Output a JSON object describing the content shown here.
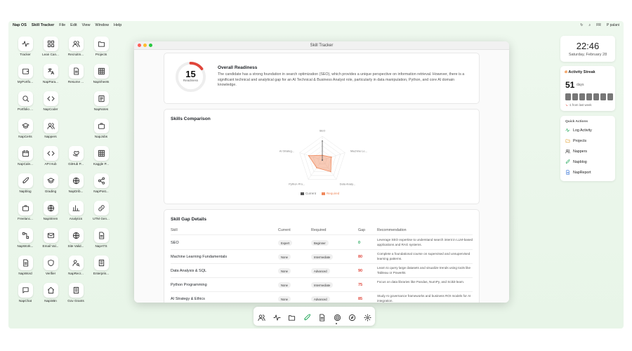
{
  "menubar": {
    "os": "Nap OS",
    "app": "Skill Tracker",
    "items": [
      "File",
      "Edit",
      "View",
      "Window",
      "Help"
    ],
    "lang": "FR",
    "user": "palani",
    "user_initial": "P"
  },
  "desktop_icons": [
    {
      "label": "Tracker",
      "icon": "activity-icon"
    },
    {
      "label": "Lean Can...",
      "icon": "grid-icon"
    },
    {
      "label": "Recruitm...",
      "icon": "users-icon"
    },
    {
      "label": "Projects",
      "icon": "folder-icon"
    },
    {
      "label": "MyPortfo...",
      "icon": "wallet-icon"
    },
    {
      "label": "NapPara...",
      "icon": "translate-icon"
    },
    {
      "label": "Resume ...",
      "icon": "document-icon"
    },
    {
      "label": "NapSheets",
      "icon": "table-icon"
    },
    {
      "label": "Portfolio ...",
      "icon": "search-icon"
    },
    {
      "label": "NapCoder",
      "icon": "code-icon"
    },
    {
      "label": "NapNotes",
      "icon": "notes-icon"
    },
    {
      "label": "NapCerts",
      "icon": "graduation-icon"
    },
    {
      "label": "Nappers",
      "icon": "users-icon"
    },
    {
      "label": "NapJobs",
      "icon": "briefcase-icon"
    },
    {
      "label": "NapCale...",
      "icon": "calendar-icon"
    },
    {
      "label": "API Hub",
      "icon": "code-icon"
    },
    {
      "label": "GitHub P...",
      "icon": "github-icon"
    },
    {
      "label": "Kaggle P...",
      "icon": "table-icon"
    },
    {
      "label": "Napblog",
      "icon": "rocket-icon"
    },
    {
      "label": "Grading",
      "icon": "graduation-icon"
    },
    {
      "label": "NapDrib...",
      "icon": "basketball-icon"
    },
    {
      "label": "NapPost...",
      "icon": "share-icon"
    },
    {
      "label": "Freelanc...",
      "icon": "briefcase-icon"
    },
    {
      "label": "NapStrem",
      "icon": "globe-icon"
    },
    {
      "label": "Analytics",
      "icon": "bar-chart-icon"
    },
    {
      "label": "UTM Gen...",
      "icon": "link-icon"
    },
    {
      "label": "NapWork...",
      "icon": "workflow-icon"
    },
    {
      "label": "Email Val...",
      "icon": "mail-icon"
    },
    {
      "label": "Site Valid...",
      "icon": "globe-icon"
    },
    {
      "label": "NapATS",
      "icon": "document-icon"
    },
    {
      "label": "NapWord",
      "icon": "document-icon"
    },
    {
      "label": "Verifier",
      "icon": "shield-icon"
    },
    {
      "label": "NapRecr...",
      "icon": "user-search-icon"
    },
    {
      "label": "Enterpris...",
      "icon": "building-icon"
    },
    {
      "label": "NapChat",
      "icon": "chat-icon"
    },
    {
      "label": "NapinBn",
      "icon": "home-icon"
    },
    {
      "label": "Gov Grants",
      "icon": "building-icon"
    }
  ],
  "window": {
    "title": "Skill Tracker"
  },
  "readiness": {
    "score": "15",
    "score_value": 15,
    "score_label": "Readiness",
    "title": "Overall Readiness",
    "text": "The candidate has a strong foundation in search optimization (SEO), which provides a unique perspective on information retrieval. However, there is a significant technical and analytical gap for an AI Technical & Business Analyst role, particularly in data manipulation, Python, and core AI domain knowledge."
  },
  "skills_comparison": {
    "title": "Skills Comparison",
    "axes": [
      "SEO",
      "Machine Le...",
      "Data Analy...",
      "Python Pro...",
      "AI Strateg..."
    ],
    "legend": [
      "Current",
      "Required"
    ],
    "current_color": "#555555",
    "required_color": "#f08a5d"
  },
  "chart_data": {
    "type": "radar",
    "categories": [
      "SEO",
      "Machine Learning Fundamentals",
      "Data Analysis & SQL",
      "Python Programming",
      "AI Strategy & Ethics"
    ],
    "series": [
      {
        "name": "Current",
        "values": [
          4,
          0,
          0,
          0,
          0
        ]
      },
      {
        "name": "Required",
        "values": [
          1,
          2,
          3,
          2,
          3
        ]
      }
    ],
    "range": [
      0,
      5
    ]
  },
  "gap_details": {
    "title": "Skill Gap Details",
    "headers": [
      "Skill",
      "Current",
      "Required",
      "Gap",
      "Recommendation"
    ],
    "rows": [
      {
        "skill": "SEO",
        "current": "Expert",
        "required": "Beginner",
        "gap": "0",
        "gap_color": "#22a75a",
        "rec": "Leverage SEO expertise to understand search intent in LLM-based applications and RAG systems."
      },
      {
        "skill": "Machine Learning Fundamentals",
        "current": "None",
        "required": "Intermediate",
        "gap": "80",
        "gap_color": "#e0453a",
        "rec": "Complete a foundational course on supervised and unsupervised learning patterns."
      },
      {
        "skill": "Data Analysis & SQL",
        "current": "None",
        "required": "Advanced",
        "gap": "90",
        "gap_color": "#e0453a",
        "rec": "Learn to query large datasets and visualize trends using tools like Tableau or PowerBI."
      },
      {
        "skill": "Python Programming",
        "current": "None",
        "required": "Intermediate",
        "gap": "75",
        "gap_color": "#e0453a",
        "rec": "Focus on data libraries like Pandas, NumPy, and Scikit-learn."
      },
      {
        "skill": "AI Strategy & Ethics",
        "current": "None",
        "required": "Advanced",
        "gap": "85",
        "gap_color": "#e0453a",
        "rec": "Study AI governance frameworks and business ROI models for AI integration."
      }
    ]
  },
  "clock": {
    "time": "22:46",
    "date": "Saturday, February 28"
  },
  "streak": {
    "title": "Activity Streak",
    "count": "51",
    "unit": "days",
    "delta": "-1 from last week"
  },
  "quick_actions": {
    "title": "Quick Actions",
    "items": [
      {
        "label": "Log Activity",
        "icon": "activity-icon",
        "color": "#22a75a"
      },
      {
        "label": "Projects",
        "icon": "folder-icon",
        "color": "#e0a030"
      },
      {
        "label": "Nappers",
        "icon": "users-icon",
        "color": "#444444"
      },
      {
        "label": "Napblog",
        "icon": "rocket-icon",
        "color": "#22a75a"
      },
      {
        "label": "NapReport",
        "icon": "document-icon",
        "color": "#2f6fd6"
      }
    ]
  },
  "dock": [
    "users-icon",
    "activity-icon",
    "folder-icon",
    "rocket-icon",
    "document-icon",
    "target-icon",
    "compass-icon",
    "gear-icon"
  ]
}
